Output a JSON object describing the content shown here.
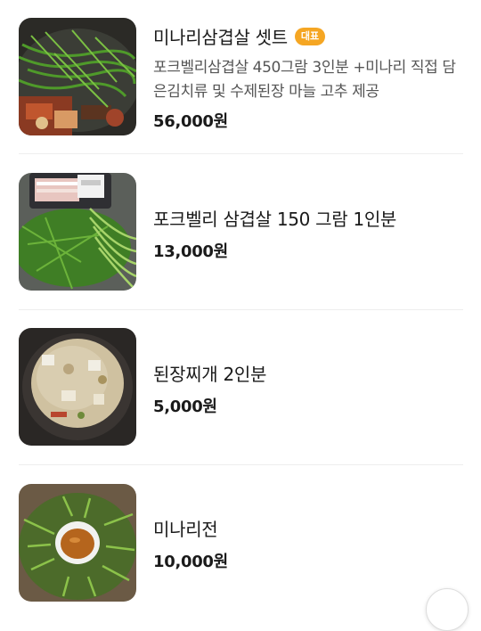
{
  "menu": {
    "items": [
      {
        "name": "미나리삼겹살 셋트",
        "badge": "대표",
        "description": "포크벨리삼겹살 450그람 3인분 +미나리 직접 담은김치류 및 수제된장 마늘 고추 제공",
        "price": "56,000원",
        "image_alt": "grilled pork belly with minari"
      },
      {
        "name": "포크벨리 삼겹살 150 그람 1인분",
        "price": "13,000원",
        "image_alt": "raw pork belly with fresh minari"
      },
      {
        "name": "된장찌개 2인분",
        "price": "5,000원",
        "image_alt": "doenjang jjigae stew in stone pot"
      },
      {
        "name": "미나리전",
        "price": "10,000원",
        "image_alt": "minari pancake with dipping sauce"
      }
    ]
  },
  "colors": {
    "badge": "#f5a623",
    "divider": "#eeeeee",
    "text_primary": "#1a1a1a",
    "text_secondary": "#555555"
  }
}
